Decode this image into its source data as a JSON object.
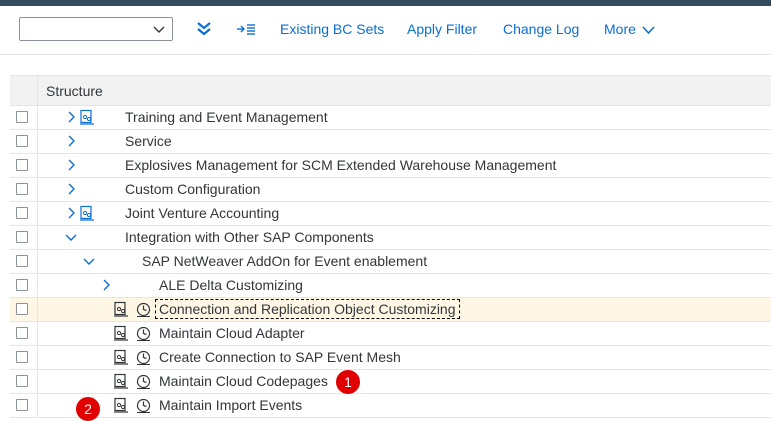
{
  "toolbar": {
    "select_value": "",
    "buttons": {
      "existing_bc_sets": "Existing BC Sets",
      "apply_filter": "Apply Filter",
      "change_log": "Change Log",
      "more": "More"
    },
    "icons": [
      "collapse-all-icon",
      "expand-icon",
      "chevron-down-icon"
    ]
  },
  "colors": {
    "shell_bar": "#354a5f",
    "link": "#0a6ed1",
    "selected_row": "#fef7e6",
    "badge": "#e00000"
  },
  "structure": {
    "header": "Structure",
    "rows": [
      {
        "label": "Training and Event Management"
      },
      {
        "label": "Service"
      },
      {
        "label": "Explosives Management for SCM Extended Warehouse Management"
      },
      {
        "label": "Custom Configuration"
      },
      {
        "label": "Joint Venture Accounting"
      },
      {
        "label": "Integration with Other SAP Components"
      },
      {
        "label": "SAP NetWeaver AddOn for Event enablement"
      },
      {
        "label": "ALE Delta Customizing"
      },
      {
        "label": "Connection and Replication Object Customizing"
      },
      {
        "label": "Maintain Cloud Adapter"
      },
      {
        "label": "Create Connection to SAP Event Mesh"
      },
      {
        "label": "Maintain Cloud Codepages"
      },
      {
        "label": "Maintain Import Events"
      }
    ]
  },
  "annotations": {
    "badge_1": "1",
    "badge_2": "2"
  }
}
